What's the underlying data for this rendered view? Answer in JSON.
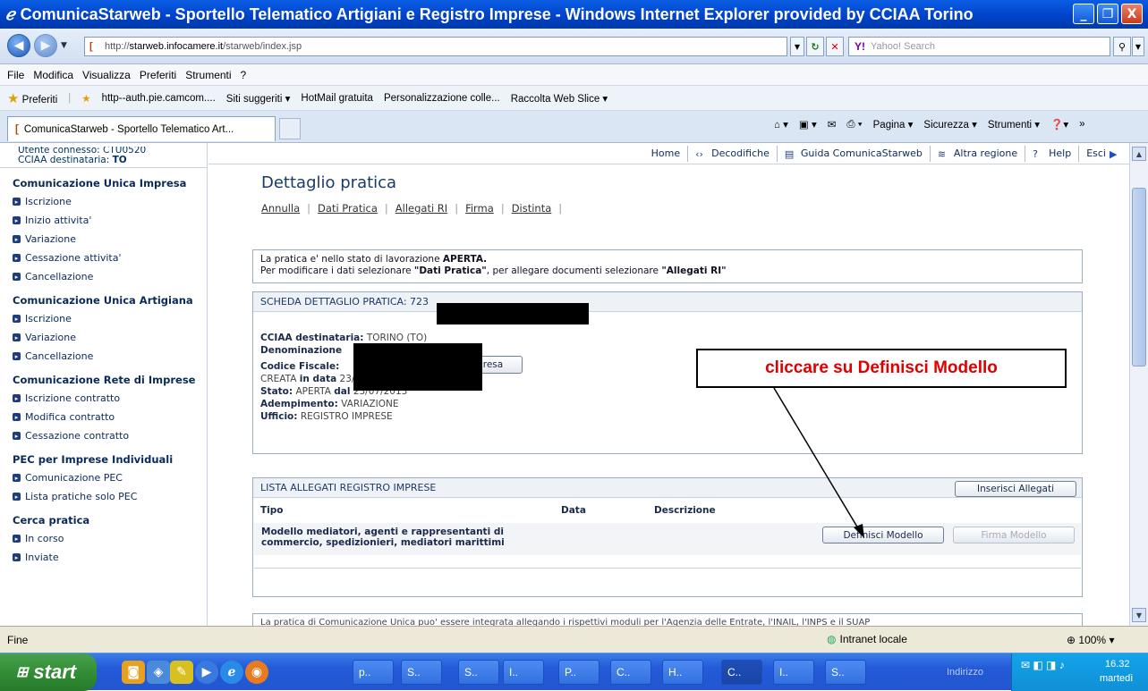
{
  "window": {
    "title": "ComunicaStarweb - Sportello Telematico Artigiani e Registro Imprese - Windows Internet Explorer provided by CCIAA Torino",
    "minimize": "_",
    "maximize": "❐",
    "close": "X"
  },
  "address": {
    "url_prefix": "http://",
    "url_host": "starweb.infocamere.it",
    "url_path": "/starweb/index.jsp",
    "search_placeholder": "Yahoo! Search",
    "search_brand": "Y!"
  },
  "menu": [
    "File",
    "Modifica",
    "Visualizza",
    "Preferiti",
    "Strumenti",
    "?"
  ],
  "favorites": {
    "label": "Preferiti",
    "items": [
      "http--auth.pie.camcom....",
      "Siti suggeriti ▾",
      "HotMail gratuita",
      "Personalizzazione colle...",
      "Raccolta Web Slice ▾"
    ]
  },
  "tabs": {
    "active": "ComunicaStarweb - Sportello Telematico Art...",
    "commands": [
      "Pagina ▾",
      "Sicurezza ▾",
      "Strumenti ▾"
    ]
  },
  "user": {
    "connected": "Utente connesso: CTU0520",
    "cciaa_label": "CCIAA destinataria:",
    "cciaa_value": "TO"
  },
  "sidebar": {
    "sections": [
      {
        "title": "Comunicazione Unica Impresa",
        "items": [
          "Iscrizione",
          "Inizio attivita'",
          "Variazione",
          "Cessazione attivita'",
          "Cancellazione"
        ]
      },
      {
        "title": "Comunicazione Unica Artigiana",
        "items": [
          "Iscrizione",
          "Variazione",
          "Cancellazione"
        ]
      },
      {
        "title": "Comunicazione Rete di Imprese",
        "items": [
          "Iscrizione contratto",
          "Modifica contratto",
          "Cessazione contratto"
        ]
      },
      {
        "title": "PEC per Imprese Individuali",
        "items": [
          "Comunicazione PEC",
          "Lista pratiche solo PEC"
        ]
      },
      {
        "title": "Cerca pratica",
        "items": [
          "In corso",
          "Inviate"
        ]
      }
    ]
  },
  "toolbar": {
    "home": "Home",
    "decodifiche": "Decodifiche",
    "guida": "Guida ComunicaStarweb",
    "altra_regione": "Altra regione",
    "help": "Help",
    "esci": "Esci"
  },
  "page": {
    "title": "Dettaglio pratica",
    "links": [
      "Annulla",
      "Dati Pratica",
      "Allegati RI",
      "Firma",
      "Distinta"
    ],
    "status_line1_pre": "La pratica e' nello stato di lavorazione ",
    "status_line1_bold": "APERTA.",
    "status_line2_pre": "Per modificare i dati selezionare ",
    "status_line2_b1": "\"Dati Pratica\"",
    "status_line2_mid": ", per allegare documenti selezionare ",
    "status_line2_b2": "\"Allegati RI\""
  },
  "scheda": {
    "header": "SCHEDA DETTAGLIO PRATICA: 723",
    "cciaa_label": "CCIAA destinataria:",
    "cciaa_value": "TORINO (TO)",
    "denominazione_label": "Denominazione",
    "codice_label": "Codice Fiscale:",
    "codice_btn": "resa",
    "creata_label": "CREATA",
    "creata_mid": "in data",
    "creata_value": "23/07/2013",
    "stato_label": "Stato:",
    "stato_value": "APERTA",
    "stato_mid": "dal",
    "stato_date": "23/07/2013",
    "adempimento_label": "Adempimento:",
    "adempimento_value": "VARIAZIONE",
    "ufficio_label": "Ufficio:",
    "ufficio_value": "REGISTRO IMPRESE"
  },
  "lista": {
    "header": "LISTA ALLEGATI REGISTRO IMPRESE",
    "inserisci": "Inserisci Allegati",
    "col_tipo": "Tipo",
    "col_data": "Data",
    "col_descrizione": "Descrizione",
    "row_line1": "Modello mediatori, agenti e rappresentanti di",
    "row_line2": "commercio, spedizionieri, mediatori marittimi",
    "definisci": "Definisci Modello",
    "firma": "Firma Modello"
  },
  "bottom_text": "La pratica di Comunicazione Unica puo' essere integrata allegando i rispettivi moduli per l'Agenzia delle Entrate, l'INAIL, l'INPS e il SUAP",
  "callout": "cliccare su Definisci Modello",
  "statusbar": {
    "text": "Fine",
    "zone": "Intranet locale",
    "zoom": "100%"
  },
  "taskbar": {
    "start": "start",
    "tasks": [
      "p..",
      "S..",
      "S..",
      "I..",
      "P..",
      "C..",
      "H..",
      "C..",
      "I..",
      "S.."
    ],
    "indirizzo": "Indirizzo",
    "time": "16.32",
    "day": "martedì"
  },
  "colors": {
    "titlebar": "#0a5ee4",
    "callout_text": "#e00000",
    "sidebar_text": "#0a2a5a"
  }
}
